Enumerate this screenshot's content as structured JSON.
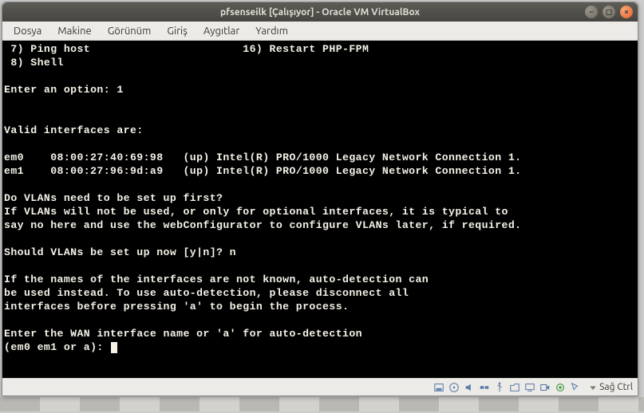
{
  "window": {
    "title": "pfsenseilk [Çalışıyor] - Oracle VM VirtualBox"
  },
  "menu": {
    "items": [
      "Dosya",
      "Makine",
      "Görünüm",
      "Giriş",
      "Aygıtlar",
      "Yardım"
    ]
  },
  "terminal": {
    "lines": [
      " 7) Ping host                       16) Restart PHP-FPM",
      " 8) Shell",
      "",
      "Enter an option: 1",
      "",
      "",
      "Valid interfaces are:",
      "",
      "em0    08:00:27:40:69:98   (up) Intel(R) PRO/1000 Legacy Network Connection 1.",
      "em1    08:00:27:96:9d:a9   (up) Intel(R) PRO/1000 Legacy Network Connection 1.",
      "",
      "Do VLANs need to be set up first?",
      "If VLANs will not be used, or only for optional interfaces, it is typical to",
      "say no here and use the webConfigurator to configure VLANs later, if required.",
      "",
      "Should VLANs be set up now [y|n]? n",
      "",
      "If the names of the interfaces are not known, auto-detection can",
      "be used instead. To use auto-detection, please disconnect all",
      "interfaces before pressing 'a' to begin the process.",
      "",
      "Enter the WAN interface name or 'a' for auto-detection",
      "(em0 em1 or a): "
    ]
  },
  "status": {
    "hostkey_label": "Sağ Ctrl",
    "icons": [
      "disk-icon",
      "cd-icon",
      "audio-icon",
      "net-icon",
      "usb-icon",
      "shared-icon",
      "display-icon",
      "record-icon",
      "cpu-icon",
      "mouse-icon"
    ]
  }
}
